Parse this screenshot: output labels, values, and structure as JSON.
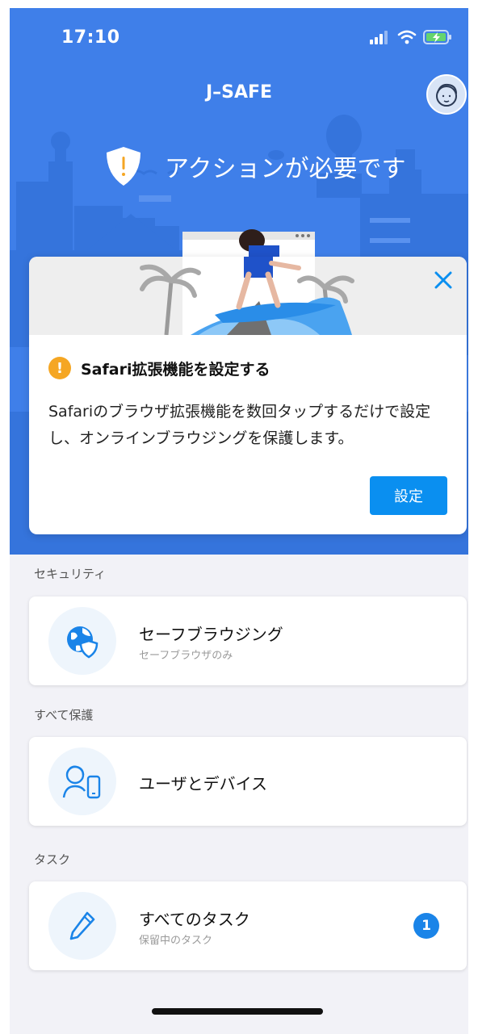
{
  "status_bar": {
    "time": "17:10"
  },
  "app": {
    "title": "J–SAFE"
  },
  "hero": {
    "action_text": "アクションが必要です"
  },
  "prompt_card": {
    "title": "Safari拡張機能を設定する",
    "description": "Safariのブラウザ拡張機能を数回タップするだけで設定し、オンラインブラウジングを保護します。",
    "button_label": "設定"
  },
  "sections": {
    "security": {
      "label": "セキュリティ",
      "item_title": "セーフブラウジング",
      "item_subtitle": "セーフブラウザのみ"
    },
    "protect_all": {
      "label": "すべて保護",
      "item_title": "ユーザとデバイス"
    },
    "tasks": {
      "label": "タスク",
      "item_title": "すべてのタスク",
      "item_subtitle": "保留中のタスク",
      "badge": "1"
    }
  },
  "colors": {
    "hero": "#3f7fe9",
    "accent": "#0a8ff0",
    "warning": "#f5a623"
  }
}
